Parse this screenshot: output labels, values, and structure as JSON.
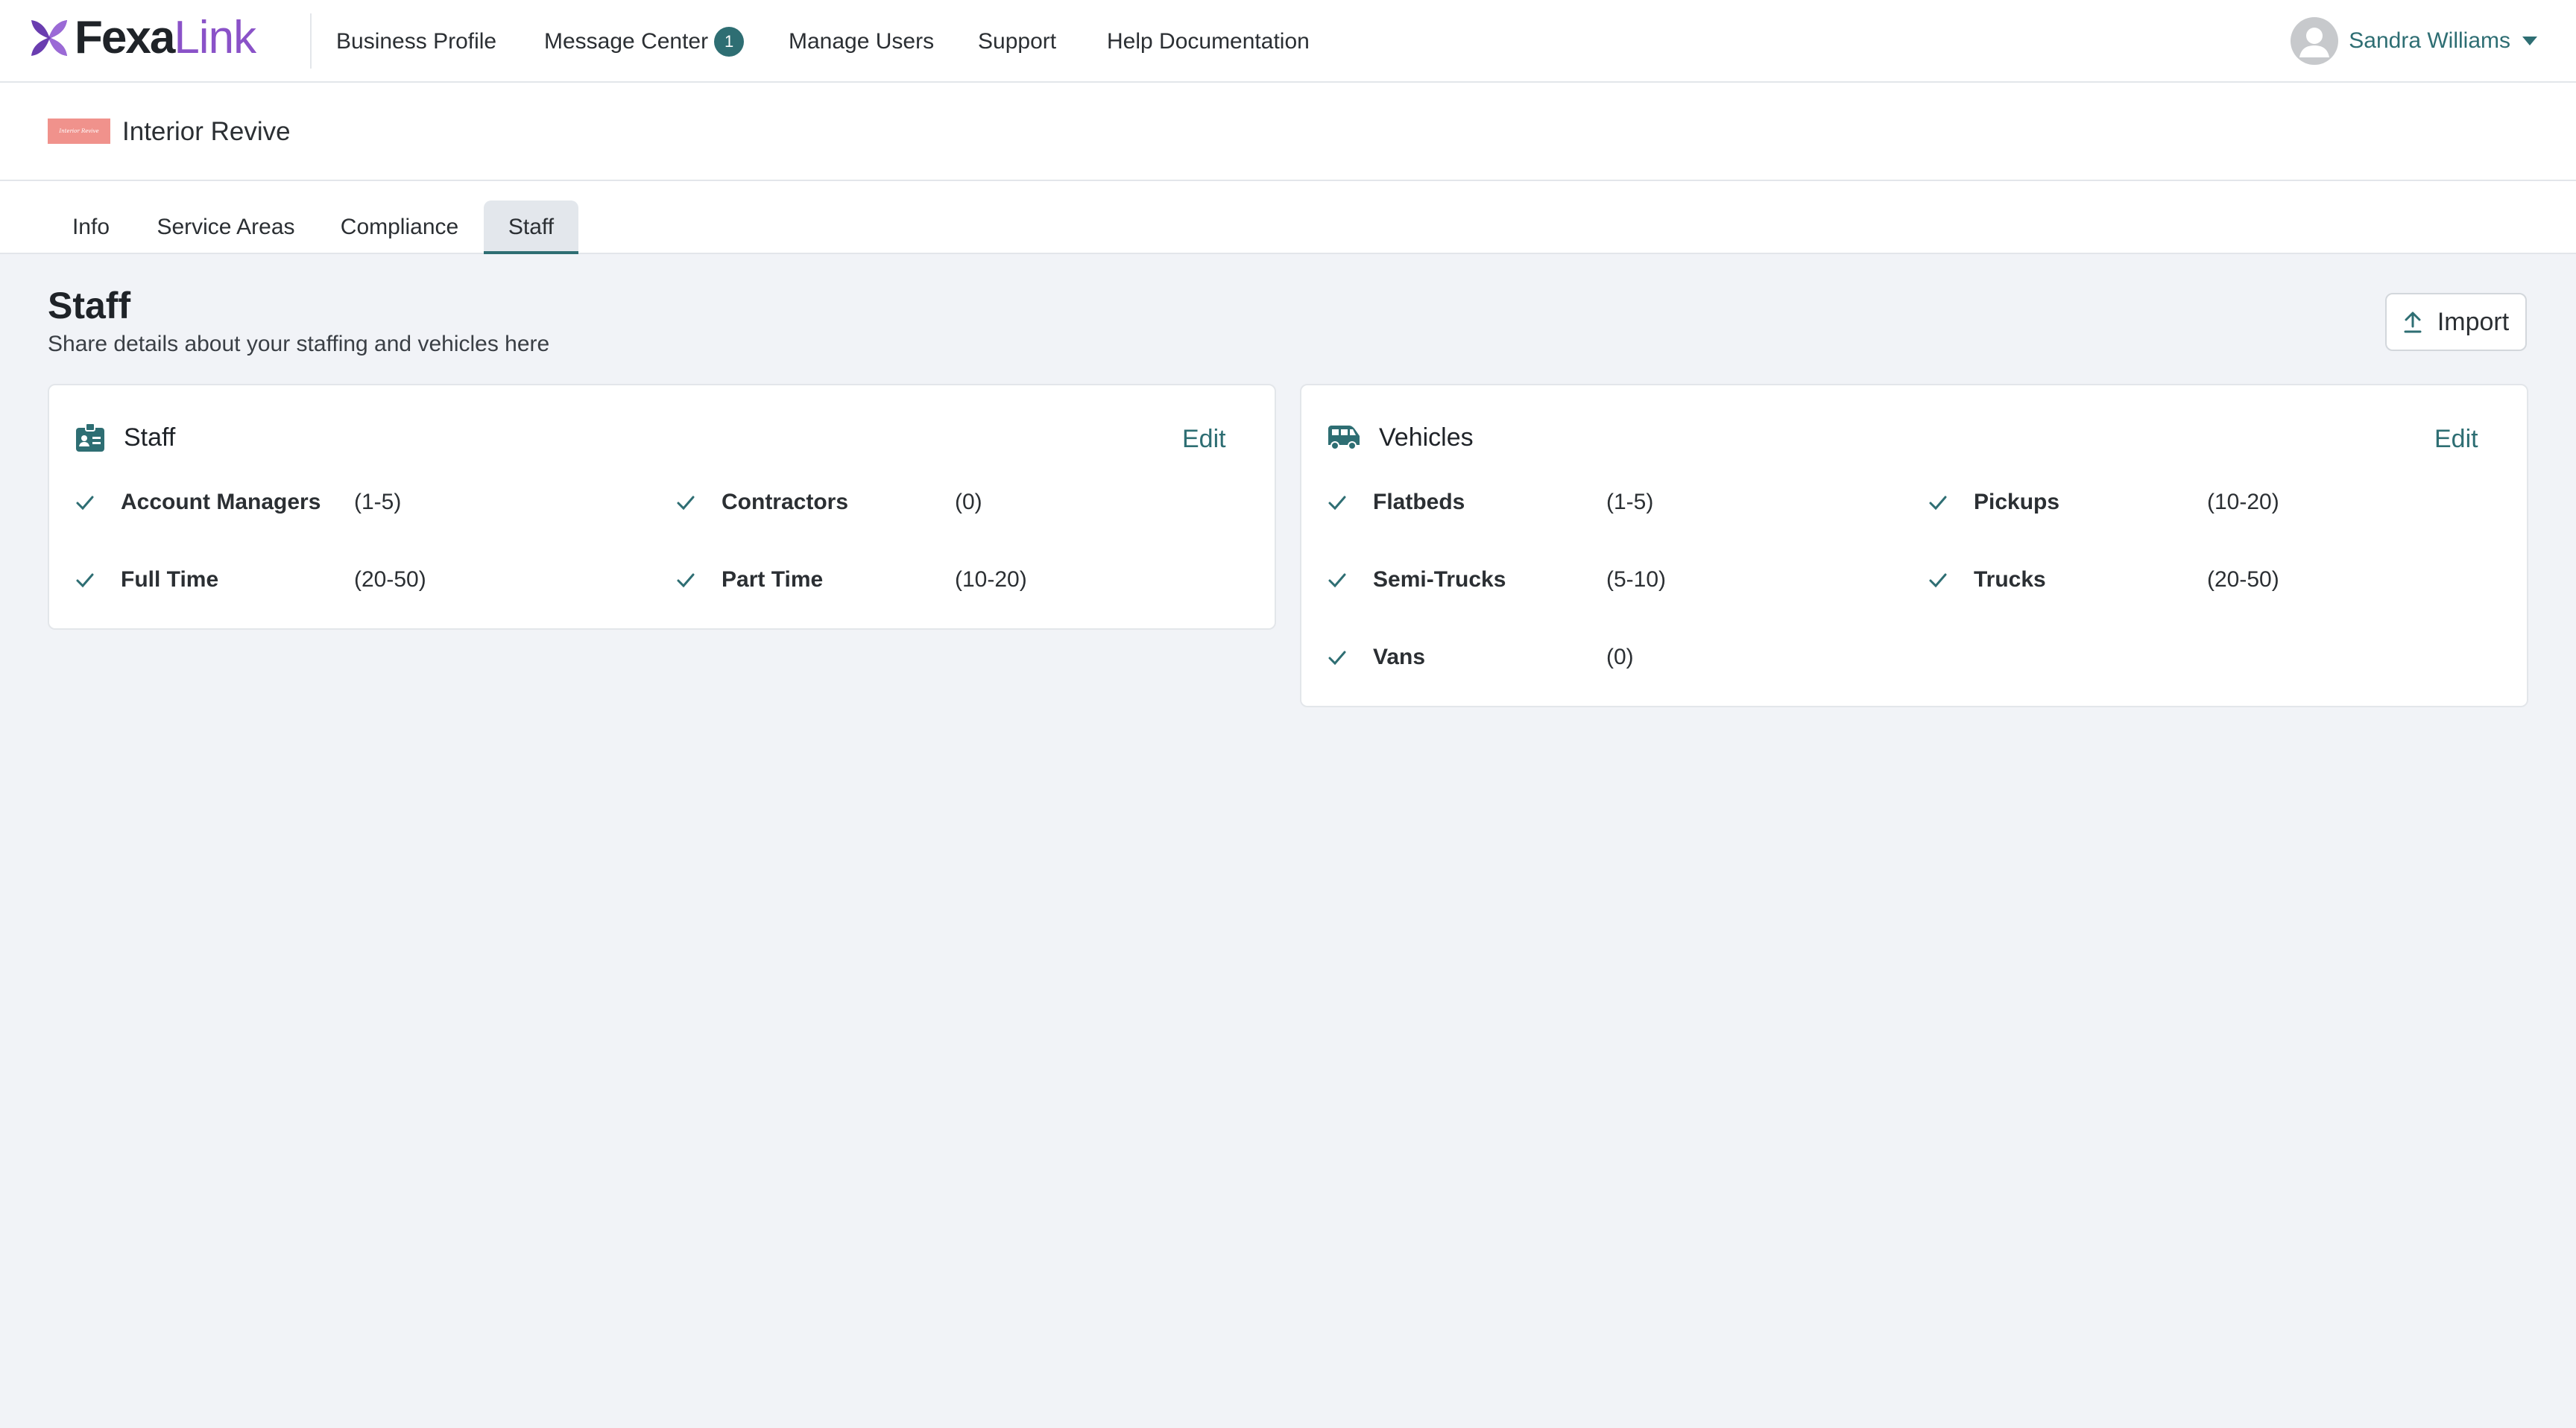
{
  "brand": {
    "name_bold": "Fexa",
    "name_light": "Link"
  },
  "nav": {
    "items": [
      "Business Profile",
      "Message Center",
      "Manage Users",
      "Support",
      "Help Documentation"
    ],
    "message_badge": "1"
  },
  "user": {
    "name": "Sandra Williams"
  },
  "company": {
    "name": "Interior Revive",
    "logo_text": "Interior Revive"
  },
  "tabs": [
    {
      "label": "Info",
      "active": false
    },
    {
      "label": "Service Areas",
      "active": false
    },
    {
      "label": "Compliance",
      "active": false
    },
    {
      "label": "Staff",
      "active": true
    }
  ],
  "page": {
    "title": "Staff",
    "subtitle": "Share details about your staffing and vehicles here",
    "import_label": "Import"
  },
  "staff_card": {
    "title": "Staff",
    "edit_label": "Edit",
    "items": [
      {
        "label": "Account Managers",
        "value": "(1-5)"
      },
      {
        "label": "Contractors",
        "value": "(0)"
      },
      {
        "label": "Full Time",
        "value": "(20-50)"
      },
      {
        "label": "Part Time",
        "value": "(10-20)"
      }
    ]
  },
  "vehicles_card": {
    "title": "Vehicles",
    "edit_label": "Edit",
    "items": [
      {
        "label": "Flatbeds",
        "value": "(1-5)"
      },
      {
        "label": "Pickups",
        "value": "(10-20)"
      },
      {
        "label": "Semi-Trucks",
        "value": "(5-10)"
      },
      {
        "label": "Trucks",
        "value": "(20-50)"
      },
      {
        "label": "Vans",
        "value": "(0)"
      }
    ]
  },
  "colors": {
    "accent": "#2e6e73",
    "brand_purple": "#8a52c8",
    "background": "#f1f3f7"
  },
  "icons": [
    "fexa-logo-icon",
    "avatar-icon",
    "chevron-down-icon",
    "upload-icon",
    "id-badge-icon",
    "van-icon",
    "check-icon"
  ]
}
